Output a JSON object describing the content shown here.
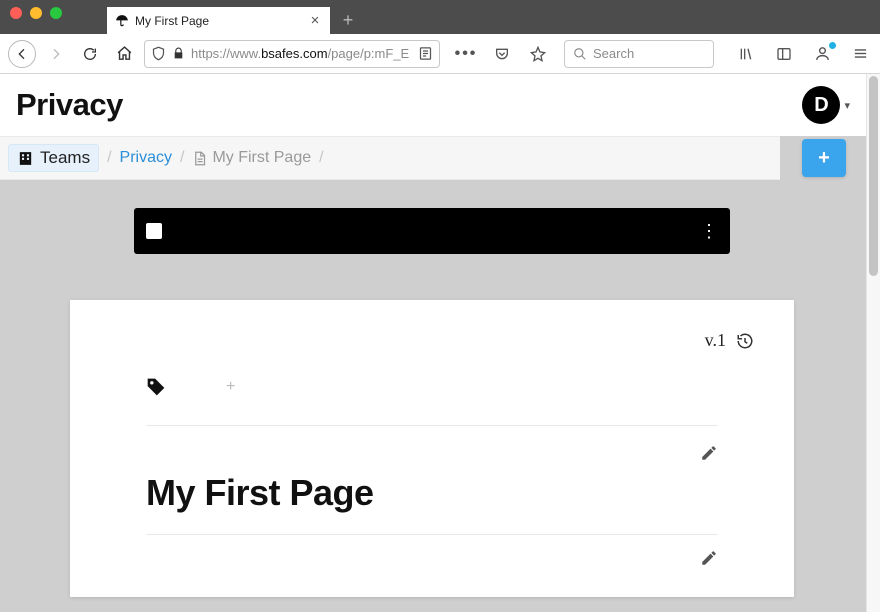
{
  "browser": {
    "tab_title": "My First Page",
    "url_prefix": "https://www.",
    "url_domain": "bsafes.com",
    "url_path": "/page/p:mF_E",
    "search_placeholder": "Search"
  },
  "app": {
    "header_title": "Privacy",
    "avatar_initial": "D"
  },
  "breadcrumb": {
    "teams_label": "Teams",
    "privacy_label": "Privacy",
    "current_label": "My First Page"
  },
  "page": {
    "version_label": "v.1",
    "title": "My First Page"
  }
}
